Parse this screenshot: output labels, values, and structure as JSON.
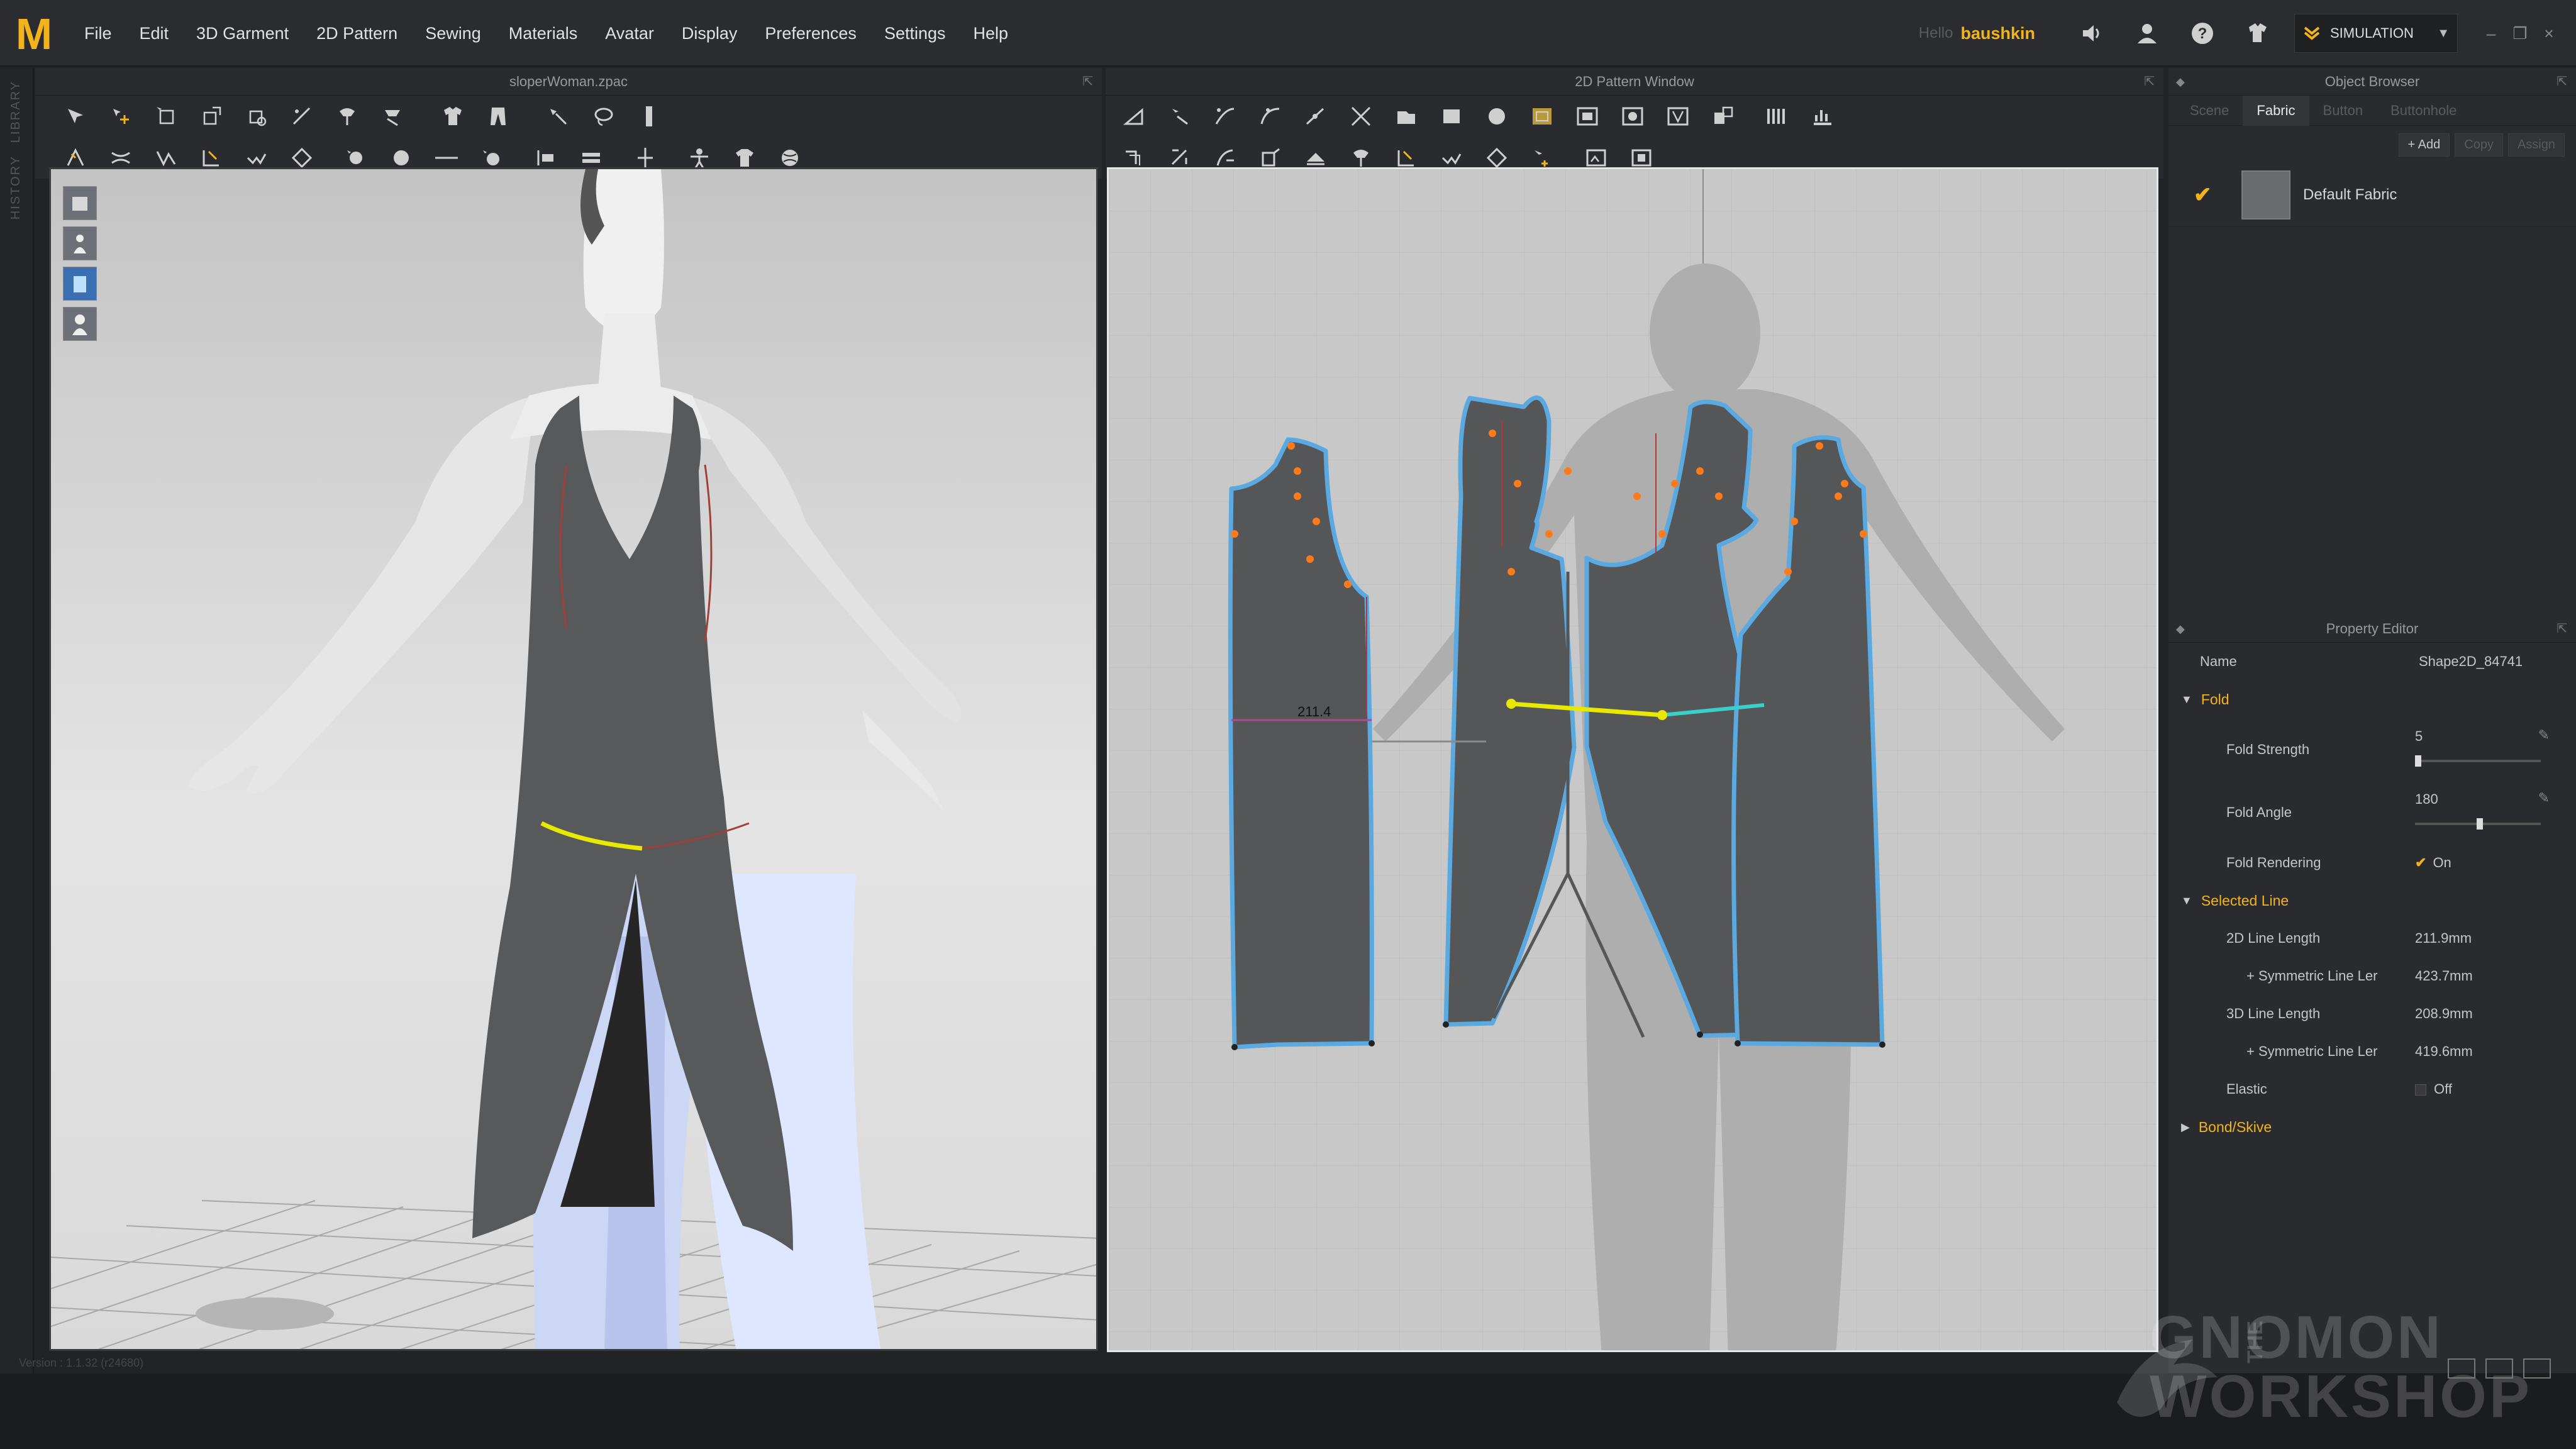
{
  "app": {
    "logo": "M",
    "menus": [
      "File",
      "Edit",
      "3D Garment",
      "2D Pattern",
      "Sewing",
      "Materials",
      "Avatar",
      "Display",
      "Preferences",
      "Settings",
      "Help"
    ],
    "user_prefix": "Hello",
    "user": "baushkin",
    "mode_label": "SIMULATION",
    "window_controls": [
      "–",
      "❐",
      "×"
    ]
  },
  "sidebar": {
    "labels": [
      "LIBRARY",
      "HISTORY"
    ]
  },
  "view3d": {
    "title": "sloperWoman.zpac"
  },
  "view2d": {
    "title": "2D Pattern Window",
    "measure_label": "211.4"
  },
  "object_browser": {
    "title": "Object Browser",
    "tabs": [
      "Scene",
      "Fabric",
      "Button",
      "Buttonhole"
    ],
    "active_tab": "Fabric",
    "tools": [
      "+ Add",
      "Copy",
      "Assign"
    ],
    "fabric_name": "Default Fabric"
  },
  "property_editor": {
    "title": "Property Editor",
    "name_label": "Name",
    "name_value": "Shape2D_84741",
    "fold_section": "Fold",
    "fold_strength_label": "Fold Strength",
    "fold_strength_value": "5",
    "fold_angle_label": "Fold Angle",
    "fold_angle_value": "180",
    "fold_rendering_label": "Fold Rendering",
    "fold_rendering_value": "On",
    "selected_line_section": "Selected Line",
    "line2d_label": "2D Line Length",
    "line2d_value": "211.9mm",
    "sym2d_label": "+ Symmetric Line Ler",
    "sym2d_value": "423.7mm",
    "line3d_label": "3D Line Length",
    "line3d_value": "208.9mm",
    "sym3d_label": "+ Symmetric Line Ler",
    "sym3d_value": "419.6mm",
    "elastic_label": "Elastic",
    "elastic_value": "Off",
    "bond_section": "Bond/Skive"
  },
  "status": {
    "text": "Version : 1.1.32 (r24680)"
  },
  "watermark": {
    "the": "THE",
    "line1": "GNOMON",
    "line2": "WORKSHOP"
  },
  "colors": {
    "accent": "#f2b31c",
    "pattern_outline": "#5aa9e0",
    "selected_line": "#e8e800",
    "garment": "#555658"
  }
}
